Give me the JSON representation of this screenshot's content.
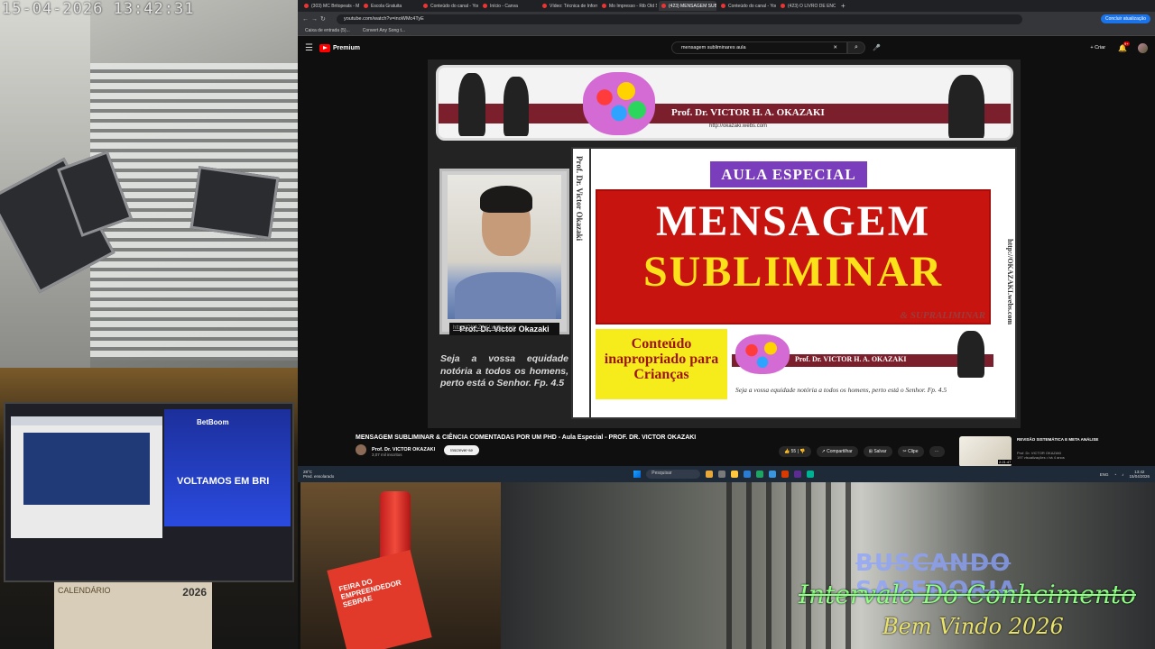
{
  "cameras": {
    "timestamp": "15-04-2026  13:42:31",
    "bottom_left": {
      "stream_text": "VOLTAMOS EM BRI",
      "stream_brand": "BetBoom",
      "calendar_label": "CALENDÁRIO",
      "calendar_year": "2026"
    },
    "bottom_mid": {
      "box_text": "FEIRA DO EMPREENDEDOR SEBRAE"
    },
    "overlay": {
      "line1": "BUSCANDO SABEDORIA",
      "line2": "Intervalo Do Conhcimento",
      "line3": "Bem Vindo 2026"
    }
  },
  "browser": {
    "tabs": [
      {
        "label": "(303) MC Britopeats - Mundo",
        "active": false
      },
      {
        "label": "Escola Gratuita",
        "active": false
      },
      {
        "label": "Conteúdo do canal - YouTube",
        "active": false
      },
      {
        "label": "Início - Canva",
        "active": false
      },
      {
        "label": "Vídeo: Técnica de Informação",
        "active": false
      },
      {
        "label": "Mo Impresso - Rib Old Seven",
        "active": false
      },
      {
        "label": "(423) MENSAGEM SUBLIMINAR",
        "active": true
      },
      {
        "label": "Conteúdo do canal - YouTube",
        "active": false
      },
      {
        "label": "(423) O LIVRO DE ENOQUE DA",
        "active": false
      }
    ],
    "url": "youtube.com/watch?v=inoWMc4TyE",
    "connect_button": "Concluir atualização",
    "bookmarks": [
      "Caixa de entrada (5)...",
      "Convert Any Song t..."
    ]
  },
  "youtube": {
    "logo": "Premium",
    "search_query": "mensagem subliminares aula",
    "create_label": "Criar",
    "notif_count": "9+",
    "video_title": "MENSAGEM SUBLIMINAR & CIÊNCIA COMENTADAS POR UM PHD - Aula Especial - PROF. DR. VICTOR OKAZAKI",
    "channel_name": "Prof. Dr. VICTOR OKAZAKI",
    "channel_subs": "3,07 mil inscritos",
    "subscribe_label": "Inscrever-se",
    "likes": "55",
    "share_label": "Compartilhar",
    "save_label": "Salvar",
    "clip_label": "Clipe",
    "related": {
      "title": "REVISÃO SISTEMÁTICA E META ANÁLISE",
      "channel": "Prof. Dr. VICTOR OKAZAKI",
      "meta": "197 visualizações • há 4 anos",
      "duration": "2:21:47"
    }
  },
  "slide": {
    "banner_name": "Prof. Dr. VICTOR H. A. OKAZAKI",
    "banner_url": "http://okazaki.webs.com",
    "photo_caption": "Prof. Dr. Victor Okazaki",
    "photo_url": "http://OKAZAKI.webs.com",
    "vertical_left": "Prof. Dr. Victor Okazaki",
    "vertical_right": "http://OKAZAKI.webs.com",
    "quote_left": "Seja a vossa equidade notória a todos os homens, perto está o Senhor. Fp. 4.5",
    "badge": "AULA ESPECIAL",
    "title_line1": "MENSAGEM",
    "title_line2": "SUBLIMINAR",
    "supra": "& SUPRALIMINAR",
    "warning": "Conteúdo inapropriado para Crianças",
    "mini_banner_name": "Prof. Dr. VICTOR H. A. OKAZAKI",
    "quote_bottom": "Seja a vossa equidade notória a todos os homens, perto está o Senhor. Fp. 4.5"
  },
  "taskbar": {
    "weather_temp": "28°C",
    "weather_desc": "Pred. ensolarado",
    "search_placeholder": "Pesquisar",
    "language": "ENG",
    "time": "13:42",
    "date": "15/04/2026"
  }
}
